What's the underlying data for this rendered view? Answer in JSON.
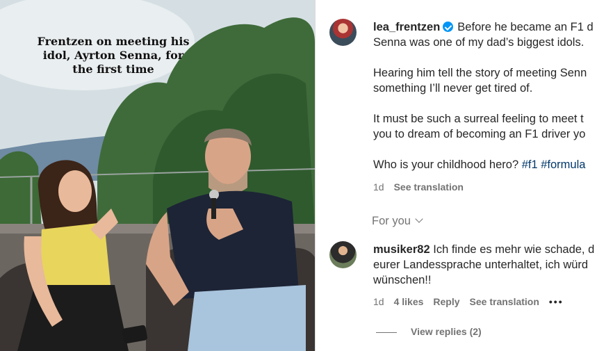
{
  "media": {
    "overlay_text": "Frentzen on meeting his idol, Ayrton Senna, for the first time"
  },
  "post": {
    "username": "lea_frentzen",
    "caption_lines": [
      "Before he became an F1 d",
      "Senna was one of my dad’s biggest idols.",
      "Hearing him tell the story of meeting Senn",
      "something I’ll never get tired of.",
      "It must be such a surreal feeling to meet t",
      "you to dream of becoming an F1 driver yo",
      "Who is your childhood hero? "
    ],
    "hashtags": [
      "#f1",
      "#formula"
    ],
    "time": "1d",
    "see_translation": "See translation"
  },
  "for_you": "For you",
  "comment": {
    "username": "musiker82",
    "lines": [
      "Ich finde es mehr wie schade, d",
      "eurer Landessprache unterhaltet, ich würd",
      "wünschen!!"
    ],
    "time": "1d",
    "likes": "4 likes",
    "reply": "Reply",
    "see_translation": "See translation",
    "more": "•••",
    "view_replies": "View replies (2)"
  },
  "colors": {
    "link_blue": "#00376b",
    "verified_blue": "#0095f6",
    "meta_gray": "#737373"
  }
}
